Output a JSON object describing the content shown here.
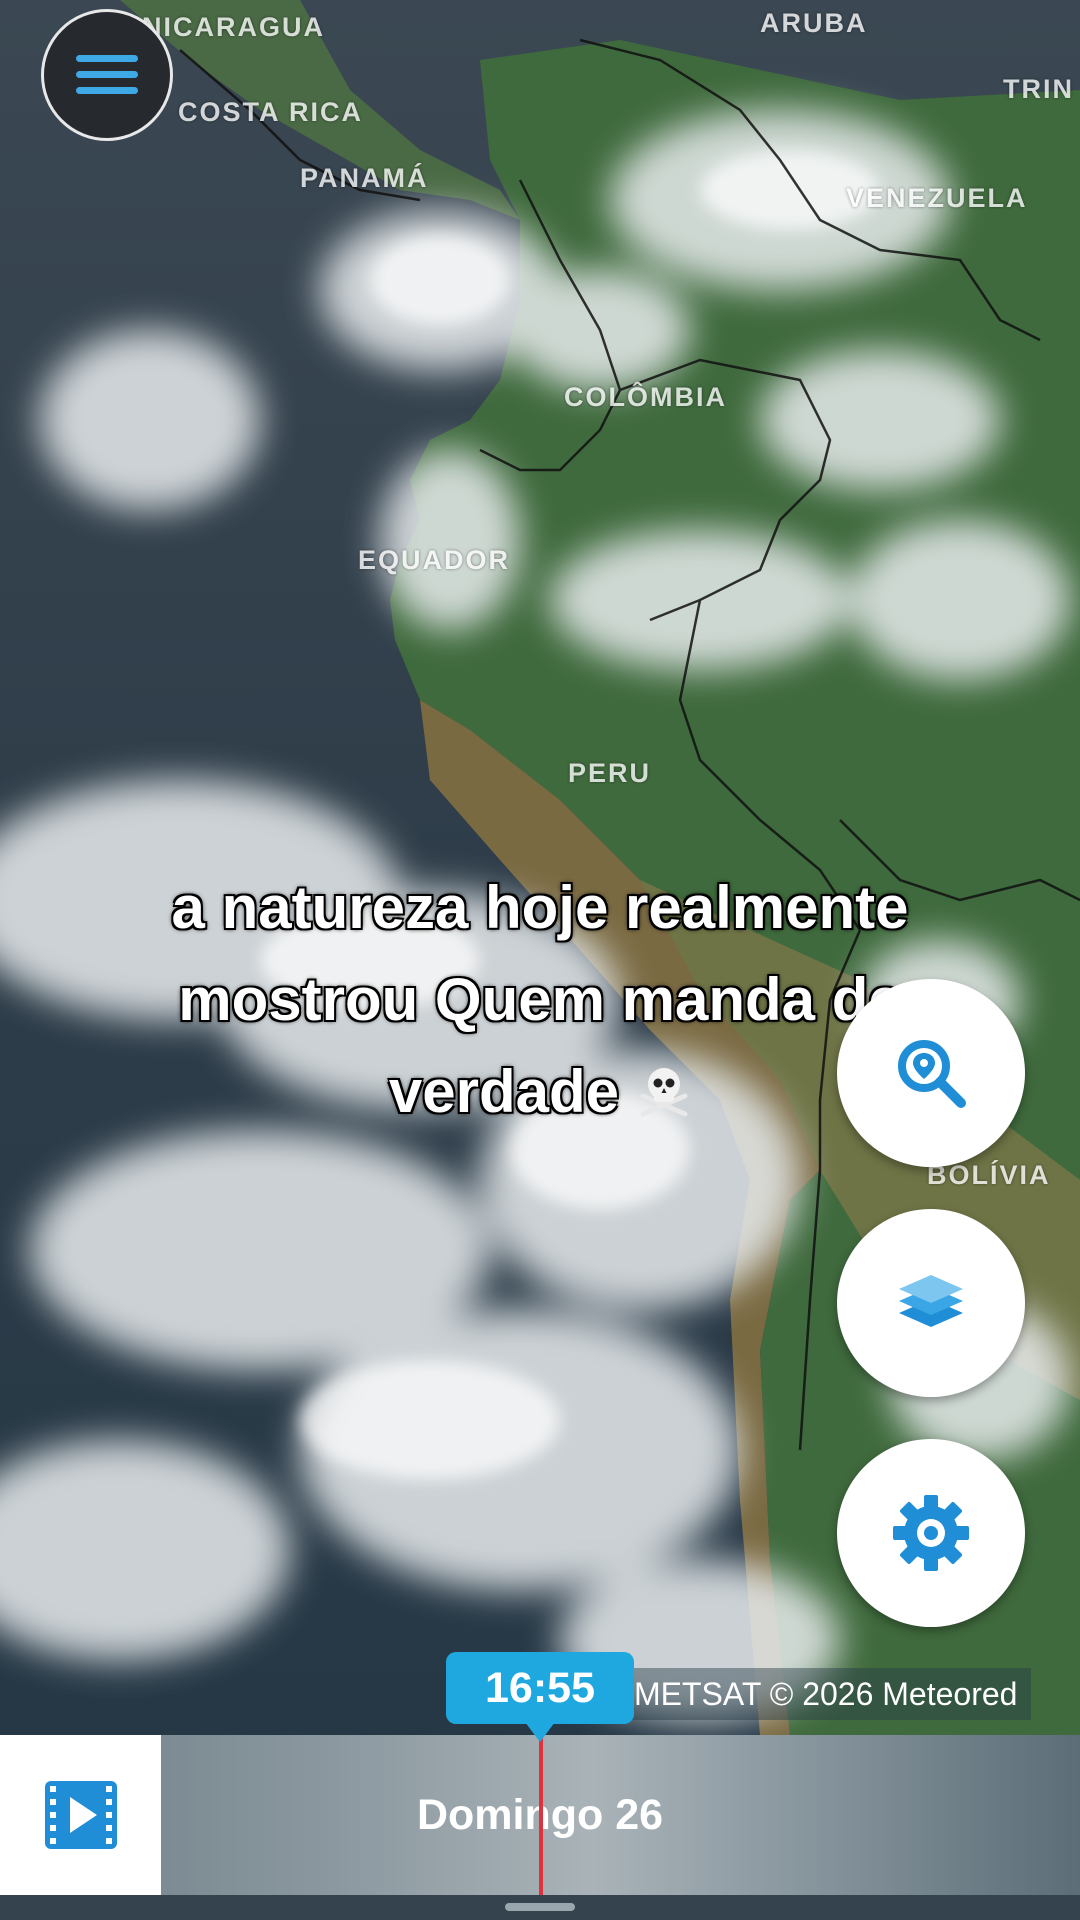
{
  "map": {
    "countries": [
      {
        "key": "nicaragua",
        "label": "NICARAGUA"
      },
      {
        "key": "aruba",
        "label": "ARUBA"
      },
      {
        "key": "trinidad",
        "label": "TRIN"
      },
      {
        "key": "costa_rica",
        "label": "COSTA RICA"
      },
      {
        "key": "panama",
        "label": "PANAMÁ"
      },
      {
        "key": "venezuela",
        "label": "VENEZUELA"
      },
      {
        "key": "colombia",
        "label": "COLÔMBIA"
      },
      {
        "key": "equador",
        "label": "EQUADOR"
      },
      {
        "key": "peru",
        "label": "PERU"
      },
      {
        "key": "bolivia",
        "label": "BOLÍVIA"
      }
    ]
  },
  "caption": {
    "line1": "a natureza hoje realmente",
    "line2": "mostrou Quem manda de",
    "line3": "verdade"
  },
  "controls": {
    "menu_icon": "hamburger-menu-icon",
    "search_icon": "search-location-icon",
    "layers_icon": "layers-icon",
    "settings_icon": "gear-icon"
  },
  "credit": "METSAT © 2026 Meteored",
  "timeline": {
    "current_time": "16:55",
    "day": "Domingo 26",
    "play_icon": "video-play-icon"
  },
  "colors": {
    "accent": "#1fa8e0",
    "time_marker": "#e0323c"
  }
}
